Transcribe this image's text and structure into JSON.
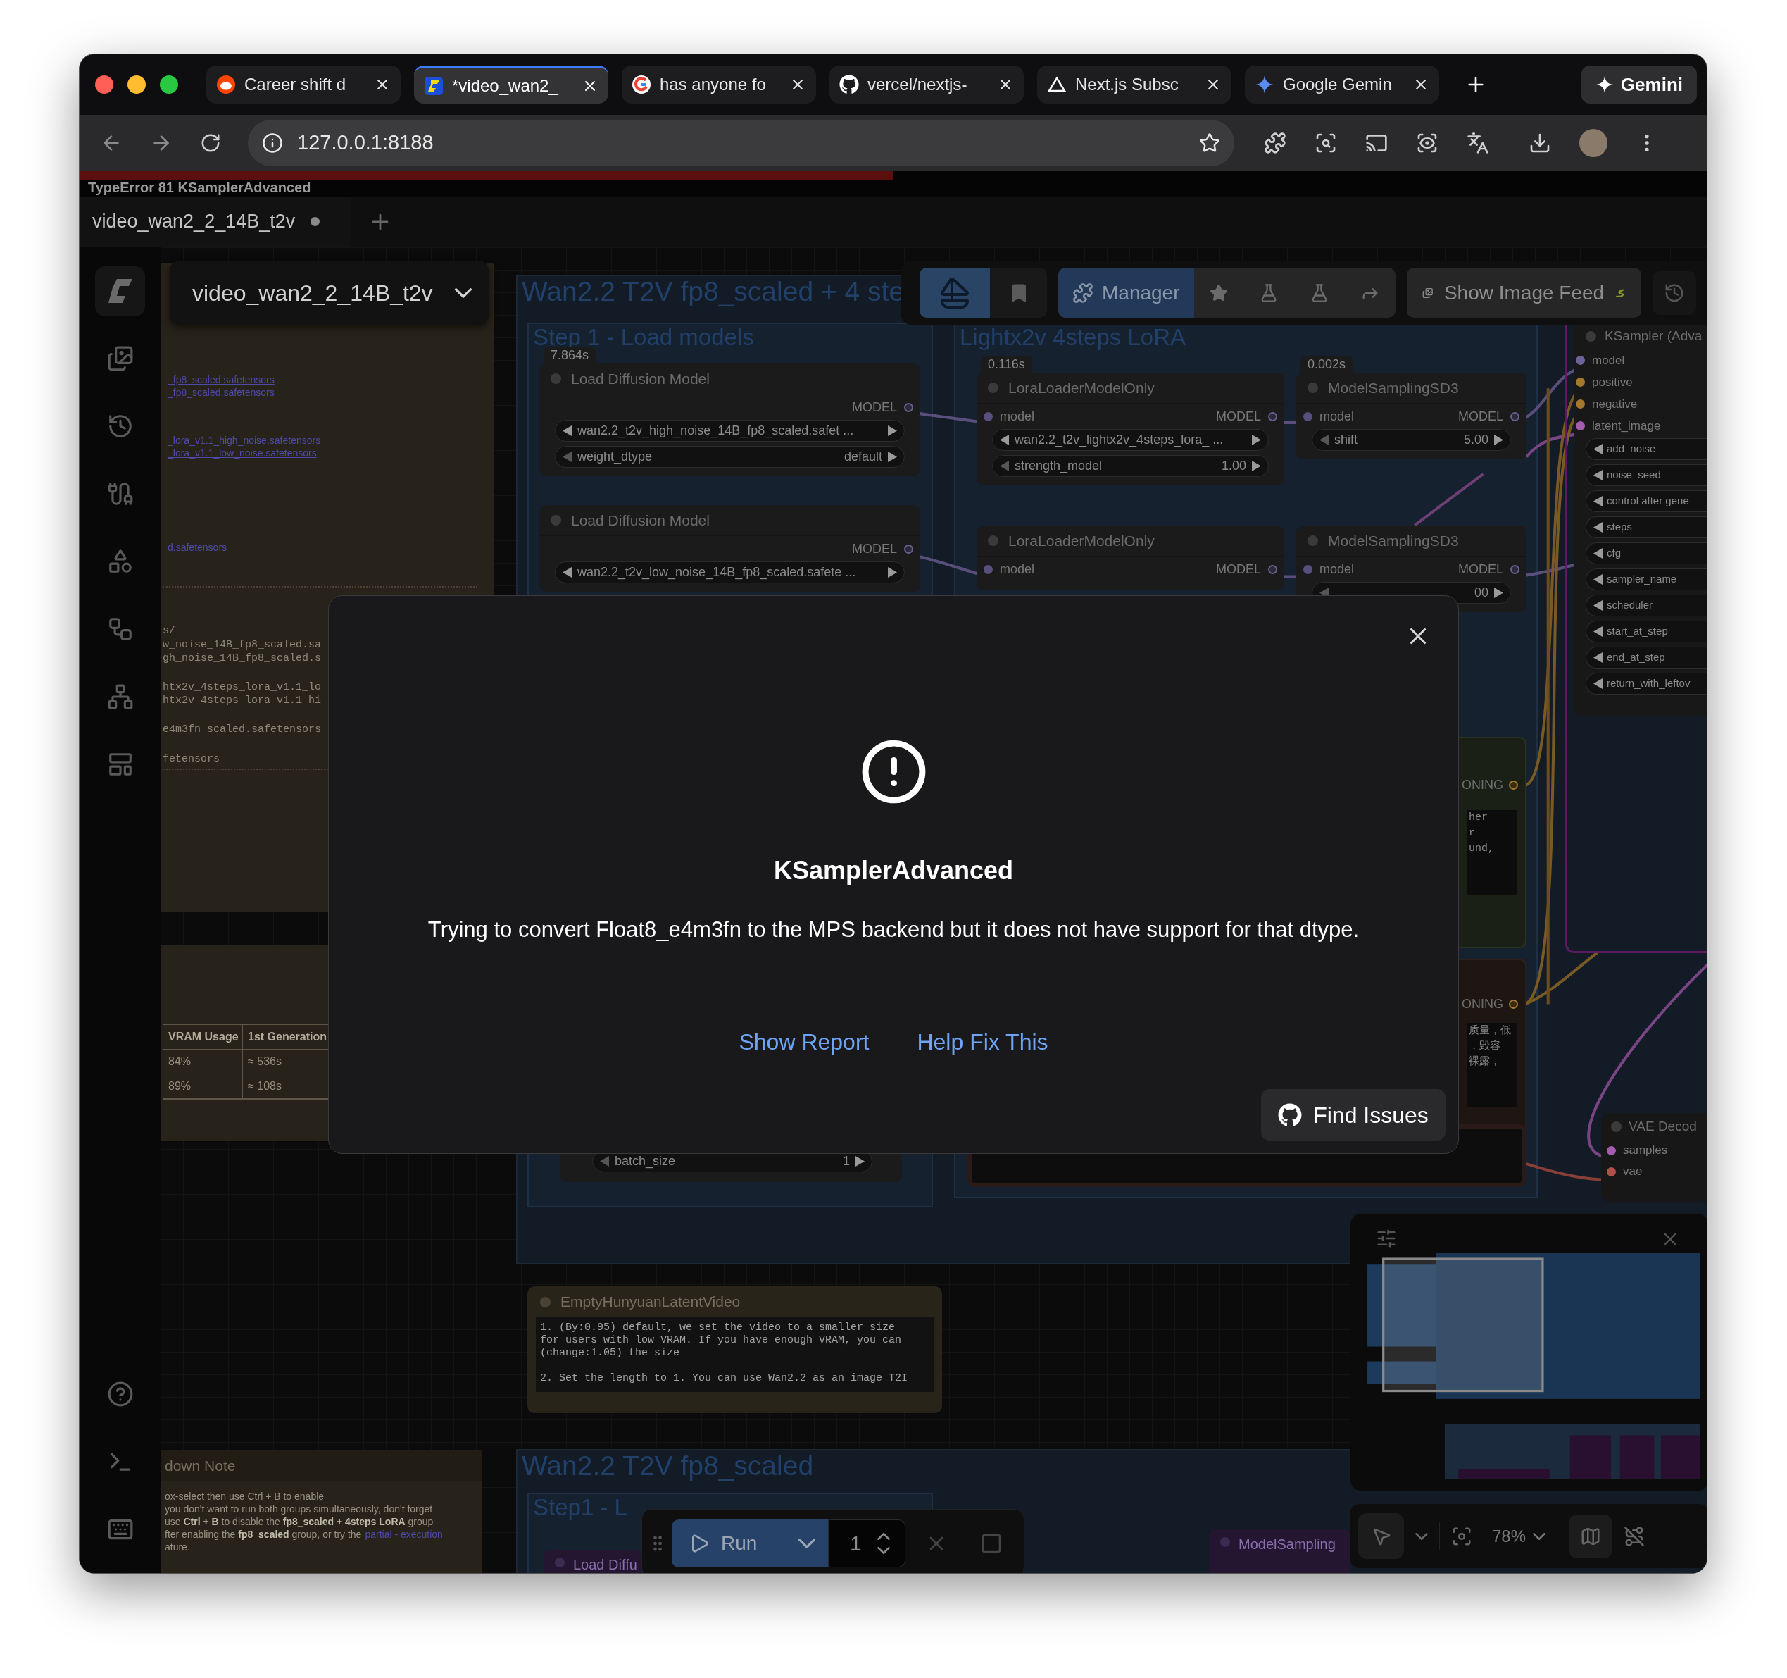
{
  "browser": {
    "tabs": [
      {
        "label": "Career shift d",
        "selected": false
      },
      {
        "label": "*video_wan2_",
        "selected": true
      },
      {
        "label": "has anyone fo",
        "selected": false
      },
      {
        "label": "vercel/nextjs-",
        "selected": false
      },
      {
        "label": "Next.js Subsc",
        "selected": false
      },
      {
        "label": "Google Gemin",
        "selected": false
      }
    ],
    "gemini_button": "Gemini",
    "address": "127.0.0.1:8188"
  },
  "app": {
    "error_banner": "TypeError 81 KSamplerAdvanced",
    "error_progress": {
      "level": 0.5
    },
    "workflow_tabs": [
      {
        "label": "video_wan2_2_14B_t2v",
        "selected": true,
        "unsaved": true
      }
    ],
    "workflow_selector": "video_wan2_2_14B_t2v",
    "toolbar": {
      "manager_button": "Manager",
      "image_feed_button": "Show Image Feed"
    },
    "note_panel": {
      "links": [
        "_fp8_scaled.safetensors",
        "_fp8_scaled.safetensors",
        "_lora_v1.1_high_noise.safetensors",
        "_lora_v1.1_low_noise.safetensors",
        "d.safetensors"
      ],
      "code_lines": [
        "s/",
        "w_noise_14B_fp8_scaled.sa",
        "gh_noise_14B_fp8_scaled.s",
        "htx2v_4steps_lora_v1.1_lo",
        "htx2v_4steps_lora_v1.1_hi",
        "e4m3fn_scaled.safetensors",
        "fetensors"
      ],
      "table": {
        "columns": [
          "VRAM Usage",
          "1st Generation"
        ],
        "rows": [
          [
            "84%",
            "≈ 536s"
          ],
          [
            "89%",
            "≈ 108s"
          ]
        ]
      }
    },
    "groups": [
      {
        "title": "Wan2.2 T2V fp8_scaled + 4 ste"
      },
      {
        "title": "Step 1 - Load models"
      },
      {
        "title": "Lightx2v 4steps LoRA"
      },
      {
        "title": "Wan2.2 T2V fp8_scaled"
      },
      {
        "title": "Step1 - L"
      }
    ],
    "nodes": [
      {
        "title": "Load Diffusion Model",
        "timing": "7.864s",
        "output": "MODEL",
        "widgets": [
          {
            "label": "wan2.2_t2v_high_noise_14B_fp8_scaled.safet ..."
          },
          {
            "label": "weight_dtype",
            "value": "default"
          }
        ]
      },
      {
        "title": "Load Diffusion Model",
        "output": "MODEL",
        "widgets": [
          {
            "label": "wan2.2_t2v_low_noise_14B_fp8_scaled.safete ..."
          }
        ]
      },
      {
        "title": "LoraLoaderModelOnly",
        "timing": "0.116s",
        "input": "model",
        "output": "MODEL",
        "widgets": [
          {
            "label": "wan2.2_t2v_lightx2v_4steps_lora_ ..."
          },
          {
            "label": "strength_model",
            "value": "1.00"
          }
        ]
      },
      {
        "title": "ModelSamplingSD3",
        "timing": "0.002s",
        "input": "model",
        "output": "MODEL",
        "widgets": [
          {
            "label": "shift",
            "value": "5.00"
          }
        ]
      },
      {
        "title": "LoraLoaderModelOnly",
        "input": "model",
        "output": "MODEL"
      },
      {
        "title": "ModelSamplingSD3",
        "input": "model",
        "output": "MODEL",
        "widgets": [
          {
            "value": "00"
          }
        ]
      }
    ],
    "ksampler": {
      "title": "KSampler (Adva",
      "inputs": [
        {
          "label": "model",
          "color": "#6f639a"
        },
        {
          "label": "positive",
          "color": "#a5782c"
        },
        {
          "label": "negative",
          "color": "#a5782c"
        },
        {
          "label": "latent_image",
          "color": "#a35cae"
        }
      ],
      "widgets": [
        "add_noise",
        "noise_seed",
        "control after gene",
        "steps",
        "cfg",
        "sampler_name",
        "scheduler",
        "start_at_step",
        "end_at_step",
        "return_with_leftov"
      ]
    },
    "fragments": [
      {
        "output": "ONING",
        "lines": [
          "her",
          "r",
          "und,"
        ]
      },
      {
        "output": "ONING",
        "lines": [
          "质量，低",
          "，毁容",
          "裸露，"
        ]
      }
    ],
    "batch_widget": {
      "label": "batch_size",
      "value": "1"
    },
    "vae_decode": {
      "title": "VAE Decod",
      "inputs": [
        {
          "label": "samples",
          "color": "#a35cae"
        },
        {
          "label": "vae",
          "color": "#b0504a"
        }
      ]
    },
    "latent_node": {
      "title": "EmptyHunyuanLatentVideo",
      "text": "1. (By:0.95) default, we set the video to a smaller size\nfor users with low VRAM. If you have enough VRAM, you can\n(change:1.05) the size\n\n2. Set the length to 1. You can use Wan2.2 as an image T2I"
    },
    "markdown_note": {
      "title": "down Note",
      "lines": [
        {
          "text": "ox-select then use Ctrl + B to enable"
        },
        {
          "text": "you don't want to run both groups simultaneously, don't forget"
        },
        {
          "text": "use **Ctrl + B** to disable the **fp8_scaled + 4steps LoRA** group"
        },
        {
          "text": "fter enabling the **fp8_scaled** group, or try the",
          "link": "partial - execution"
        },
        {
          "text": "ature."
        }
      ]
    },
    "dim_nodes": [
      {
        "title": "Load Diffu"
      },
      {
        "title": "ModelSampling"
      }
    ],
    "run_bar": {
      "run_button": "Run",
      "batch_count": "1"
    },
    "zoom_level": "78%"
  },
  "dialog": {
    "title": "KSamplerAdvanced",
    "message": "Trying to convert Float8_e4m3fn to the MPS backend but it does not have support for that dtype.",
    "links": [
      "Show Report",
      "Help Fix This"
    ],
    "button": "Find Issues"
  }
}
